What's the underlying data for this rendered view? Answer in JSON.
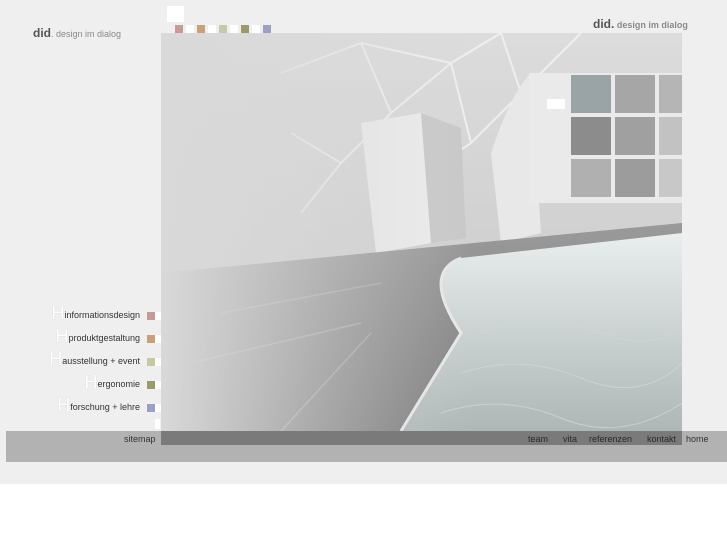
{
  "logo_left": {
    "brand": "did",
    "tagline": ". design im dialog"
  },
  "logo_right": {
    "brand": "did.",
    "tagline": " design im dialog"
  },
  "colors": {
    "swatches": [
      "#c79a96",
      "#ffffff",
      "#c9a07a",
      "#ffffff",
      "#c7c9a4",
      "#ffffff",
      "#9c9a6c",
      "#ffffff",
      "#9e9fc7"
    ]
  },
  "hero": {
    "image": "3d exhibition space rendering with water channel and display wall"
  },
  "nav": [
    {
      "letter": "H",
      "label": "informationsdesign",
      "color": "#c79a96"
    },
    {
      "letter": "H",
      "label": "produktgestaltung",
      "color": "#c9a07a"
    },
    {
      "letter": "H",
      "label": "ausstellung + event",
      "color": "#c7c9a4"
    },
    {
      "letter": "H",
      "label": "ergonomie",
      "color": "#9c9a6c"
    },
    {
      "letter": "H",
      "label": "forschung + lehre",
      "color": "#9e9fc7"
    }
  ],
  "footer": {
    "sitemap": "sitemap",
    "links": [
      "team",
      "vita",
      "referenzen",
      "kontakt",
      "home"
    ]
  }
}
